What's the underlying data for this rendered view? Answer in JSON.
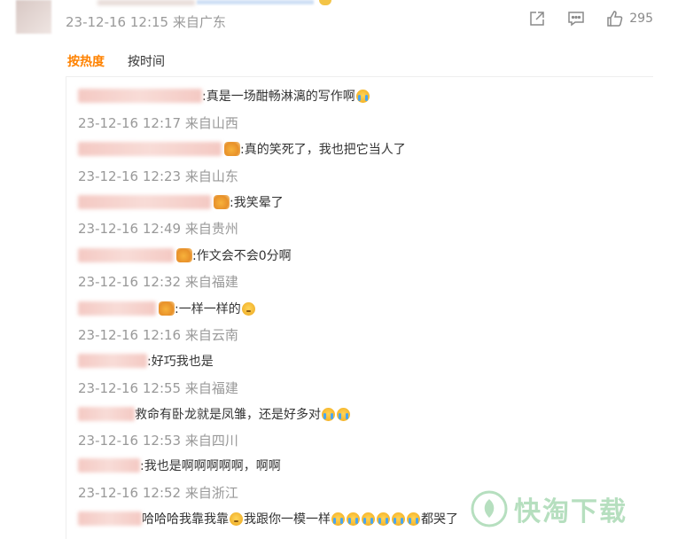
{
  "post": {
    "timestamp": "23-12-16 12:15",
    "location": "来自广东",
    "like_count": "295"
  },
  "sort_tabs": {
    "hot": "按热度",
    "time": "按时间"
  },
  "comments": [
    {
      "text": ":真是一场酣畅淋漓的写作啊",
      "meta_time": "23-12-16 12:17",
      "meta_location": "来自山西"
    },
    {
      "text": ":真的笑死了，我也把它当人了",
      "meta_time": "23-12-16 12:23",
      "meta_location": "来自山东"
    },
    {
      "text": ":我笑晕了",
      "meta_time": "23-12-16 12:49",
      "meta_location": "来自贵州"
    },
    {
      "text": ":作文会不会0分啊",
      "meta_time": "23-12-16 12:32",
      "meta_location": "来自福建"
    },
    {
      "text": ":一样一样的",
      "meta_time": "23-12-16 12:16",
      "meta_location": "来自云南"
    },
    {
      "text": ":好巧我也是",
      "meta_time": "23-12-16 12:55",
      "meta_location": "来自福建"
    },
    {
      "text": "救命有卧龙就是凤雏，还是好多对",
      "meta_time": "23-12-16 12:53",
      "meta_location": "来自四川"
    },
    {
      "text": ":我也是啊啊啊啊啊，啊啊",
      "meta_time": "23-12-16 12:52",
      "meta_location": "来自浙江"
    },
    {
      "text_a": "哈哈哈我靠我靠",
      "text_b": "我跟你一模一样",
      "text_c": "都哭了"
    }
  ],
  "watermark": "快淘下载",
  "colors": {
    "accent": "#ff8200",
    "meta_gray": "#999999",
    "text": "#333333",
    "watermark_green": "#7cc58c"
  },
  "icons": [
    "forward-icon",
    "comment-icon",
    "like-icon",
    "cry-emoji",
    "think-emoji",
    "user-badge-icon"
  ]
}
